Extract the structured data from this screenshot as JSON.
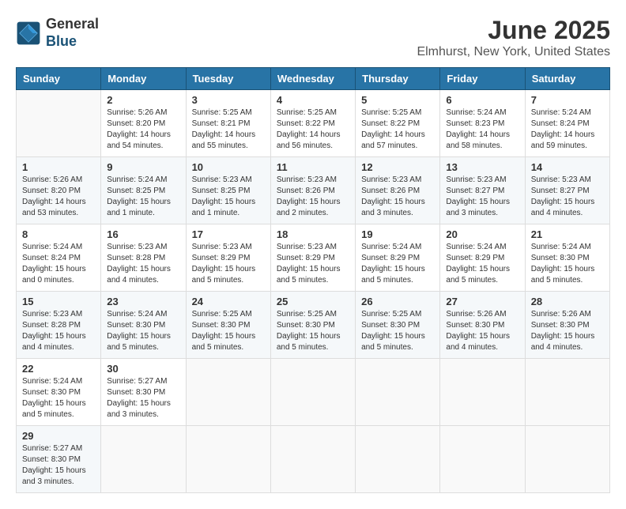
{
  "header": {
    "logo_line1": "General",
    "logo_line2": "Blue",
    "title": "June 2025",
    "subtitle": "Elmhurst, New York, United States"
  },
  "calendar": {
    "days_of_week": [
      "Sunday",
      "Monday",
      "Tuesday",
      "Wednesday",
      "Thursday",
      "Friday",
      "Saturday"
    ],
    "weeks": [
      [
        {
          "day": "",
          "info": ""
        },
        {
          "day": "2",
          "info": "Sunrise: 5:26 AM\nSunset: 8:20 PM\nDaylight: 14 hours\nand 54 minutes."
        },
        {
          "day": "3",
          "info": "Sunrise: 5:25 AM\nSunset: 8:21 PM\nDaylight: 14 hours\nand 55 minutes."
        },
        {
          "day": "4",
          "info": "Sunrise: 5:25 AM\nSunset: 8:22 PM\nDaylight: 14 hours\nand 56 minutes."
        },
        {
          "day": "5",
          "info": "Sunrise: 5:25 AM\nSunset: 8:22 PM\nDaylight: 14 hours\nand 57 minutes."
        },
        {
          "day": "6",
          "info": "Sunrise: 5:24 AM\nSunset: 8:23 PM\nDaylight: 14 hours\nand 58 minutes."
        },
        {
          "day": "7",
          "info": "Sunrise: 5:24 AM\nSunset: 8:24 PM\nDaylight: 14 hours\nand 59 minutes."
        }
      ],
      [
        {
          "day": "1",
          "info": "Sunrise: 5:26 AM\nSunset: 8:20 PM\nDaylight: 14 hours\nand 53 minutes."
        },
        {
          "day": "9",
          "info": "Sunrise: 5:24 AM\nSunset: 8:25 PM\nDaylight: 15 hours\nand 1 minute."
        },
        {
          "day": "10",
          "info": "Sunrise: 5:23 AM\nSunset: 8:25 PM\nDaylight: 15 hours\nand 1 minute."
        },
        {
          "day": "11",
          "info": "Sunrise: 5:23 AM\nSunset: 8:26 PM\nDaylight: 15 hours\nand 2 minutes."
        },
        {
          "day": "12",
          "info": "Sunrise: 5:23 AM\nSunset: 8:26 PM\nDaylight: 15 hours\nand 3 minutes."
        },
        {
          "day": "13",
          "info": "Sunrise: 5:23 AM\nSunset: 8:27 PM\nDaylight: 15 hours\nand 3 minutes."
        },
        {
          "day": "14",
          "info": "Sunrise: 5:23 AM\nSunset: 8:27 PM\nDaylight: 15 hours\nand 4 minutes."
        }
      ],
      [
        {
          "day": "8",
          "info": "Sunrise: 5:24 AM\nSunset: 8:24 PM\nDaylight: 15 hours\nand 0 minutes."
        },
        {
          "day": "16",
          "info": "Sunrise: 5:23 AM\nSunset: 8:28 PM\nDaylight: 15 hours\nand 4 minutes."
        },
        {
          "day": "17",
          "info": "Sunrise: 5:23 AM\nSunset: 8:29 PM\nDaylight: 15 hours\nand 5 minutes."
        },
        {
          "day": "18",
          "info": "Sunrise: 5:23 AM\nSunset: 8:29 PM\nDaylight: 15 hours\nand 5 minutes."
        },
        {
          "day": "19",
          "info": "Sunrise: 5:24 AM\nSunset: 8:29 PM\nDaylight: 15 hours\nand 5 minutes."
        },
        {
          "day": "20",
          "info": "Sunrise: 5:24 AM\nSunset: 8:29 PM\nDaylight: 15 hours\nand 5 minutes."
        },
        {
          "day": "21",
          "info": "Sunrise: 5:24 AM\nSunset: 8:30 PM\nDaylight: 15 hours\nand 5 minutes."
        }
      ],
      [
        {
          "day": "15",
          "info": "Sunrise: 5:23 AM\nSunset: 8:28 PM\nDaylight: 15 hours\nand 4 minutes."
        },
        {
          "day": "23",
          "info": "Sunrise: 5:24 AM\nSunset: 8:30 PM\nDaylight: 15 hours\nand 5 minutes."
        },
        {
          "day": "24",
          "info": "Sunrise: 5:25 AM\nSunset: 8:30 PM\nDaylight: 15 hours\nand 5 minutes."
        },
        {
          "day": "25",
          "info": "Sunrise: 5:25 AM\nSunset: 8:30 PM\nDaylight: 15 hours\nand 5 minutes."
        },
        {
          "day": "26",
          "info": "Sunrise: 5:25 AM\nSunset: 8:30 PM\nDaylight: 15 hours\nand 5 minutes."
        },
        {
          "day": "27",
          "info": "Sunrise: 5:26 AM\nSunset: 8:30 PM\nDaylight: 15 hours\nand 4 minutes."
        },
        {
          "day": "28",
          "info": "Sunrise: 5:26 AM\nSunset: 8:30 PM\nDaylight: 15 hours\nand 4 minutes."
        }
      ],
      [
        {
          "day": "22",
          "info": "Sunrise: 5:24 AM\nSunset: 8:30 PM\nDaylight: 15 hours\nand 5 minutes."
        },
        {
          "day": "30",
          "info": "Sunrise: 5:27 AM\nSunset: 8:30 PM\nDaylight: 15 hours\nand 3 minutes."
        },
        {
          "day": "",
          "info": ""
        },
        {
          "day": "",
          "info": ""
        },
        {
          "day": "",
          "info": ""
        },
        {
          "day": "",
          "info": ""
        },
        {
          "day": "",
          "info": ""
        }
      ],
      [
        {
          "day": "29",
          "info": "Sunrise: 5:27 AM\nSunset: 8:30 PM\nDaylight: 15 hours\nand 3 minutes."
        },
        {
          "day": "",
          "info": ""
        },
        {
          "day": "",
          "info": ""
        },
        {
          "day": "",
          "info": ""
        },
        {
          "day": "",
          "info": ""
        },
        {
          "day": "",
          "info": ""
        },
        {
          "day": "",
          "info": ""
        }
      ]
    ]
  }
}
